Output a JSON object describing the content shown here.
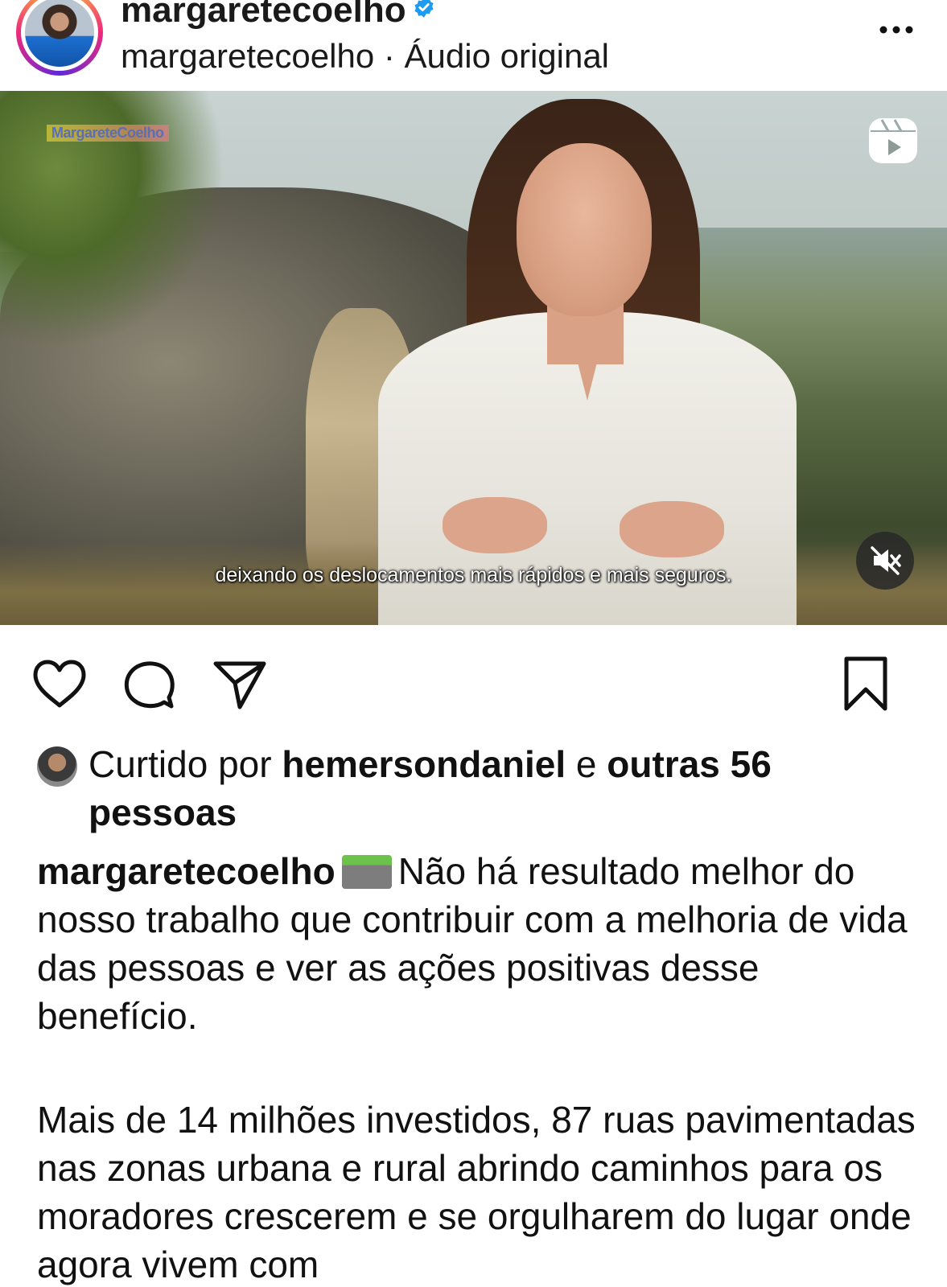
{
  "header": {
    "username": "margaretecoelho",
    "subline": "margaretecoelho · Áudio original",
    "verified_color": "#1D9BF0"
  },
  "video": {
    "watermark": "MargareteCoelho",
    "subtitle": "deixando os deslocamentos mais rápidos e mais seguros.",
    "icons": [
      "reels-icon",
      "muted-speaker-icon"
    ]
  },
  "actions": {
    "icons": [
      "heart-icon",
      "comment-icon",
      "share-icon",
      "bookmark-icon"
    ]
  },
  "likes": {
    "prefix": "Curtido por ",
    "liker": "hemersondaniel",
    "middle": " e ",
    "others": "outras 56 pessoas"
  },
  "caption": {
    "username": "margaretecoelho",
    "text": "Não há resultado melhor do nosso trabalho que contribuir com a melhoria de vida das pessoas e ver as ações positivas desse benefício.",
    "paragraph2": "Mais de 14 milhões investidos, 87 ruas pavimentadas nas zonas urbana e rural abrindo caminhos para os moradores crescerem e se orgulharem do lugar onde agora vivem com"
  }
}
